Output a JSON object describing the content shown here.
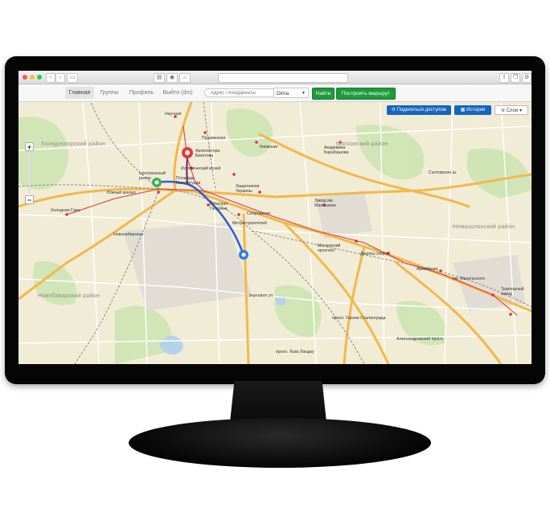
{
  "nav": {
    "tabs": [
      {
        "label": "Главная"
      },
      {
        "label": "Группы"
      },
      {
        "label": "Профиль"
      },
      {
        "label": "Выйти (dm)"
      }
    ],
    "search_placeholder": "Адрес / Координаты",
    "user_select": "Dima",
    "find_button": "Найти",
    "route_button": "Построить маршрут"
  },
  "map_toolbar": {
    "share_button": "Поделиться доступом",
    "history_button": "История",
    "layers_button": "Слои"
  },
  "zoom": {
    "plus": "+",
    "minus": "−"
  },
  "districts": [
    "Московский район",
    "Немышлянский район",
    "Холодногорский район",
    "Новобаварский район"
  ],
  "labels": {
    "naukova": "Научная",
    "pushkinskaya": "Пушкинская",
    "kievskaya": "Киевская",
    "architektora": "Архитектора Бекетова",
    "istmuzey": "Исторический музей",
    "centr_rynok": "Центральный рынок",
    "ploshad": "Площадь Конституции",
    "yuzhny": "Южный вокзал",
    "holodnaya": "Холодная Гора",
    "zashitnikov": "Защитников Украины",
    "prospekt_gag": "Проспект Гагарина",
    "sportivnaya": "Спортивная",
    "metrostroiteley": "Метростроителей",
    "zavod_malysheva": "Завод им. Малышева",
    "moskovsky_pr": "Московский проспект",
    "dvorets": "Дворец спорта",
    "armeyskaya": "Армейская",
    "maselskogo": "им. Масельского",
    "traktorny": "Тракторный завод",
    "akademika": "Академика Барабашова",
    "saltovskoe": "Салтовское ш.",
    "geroev_stalingrada": "просп. Героев Сталинграда",
    "lva_landau": "просп. Льва Ландау",
    "novosibirskaya": "Новосибирская",
    "aleksandrovsky": "Александровский просп.",
    "zernovaya": "Зерновая ул."
  },
  "colors": {
    "route": "#2f5fd0",
    "start_marker": "#e23b3b",
    "mid_marker": "#3bb44a",
    "end_marker": "#2f7de0",
    "primary": "#1565c0",
    "green": "#1d9b3a"
  }
}
